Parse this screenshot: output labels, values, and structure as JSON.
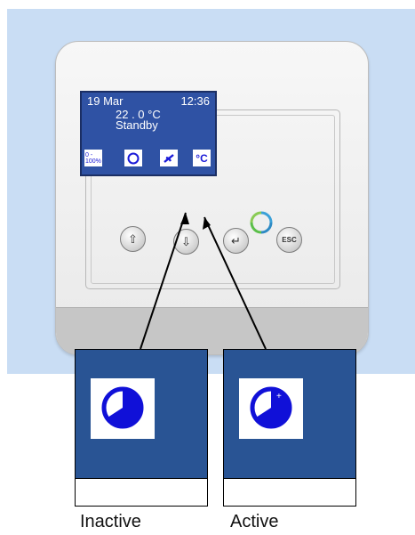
{
  "display": {
    "date": "19 Mar",
    "time": "12:36",
    "temperature": "22 . 0 °C",
    "status": "Standby",
    "icons": {
      "range_label": "0 -\n100%",
      "moon": "moon-icon",
      "fan": "fan-icon",
      "celsius": "°C"
    }
  },
  "buttons": {
    "up": "⇧",
    "down": "⇩",
    "enter": "↵",
    "esc": "ESC"
  },
  "callouts": {
    "inactive_label": "Inactive",
    "active_label": "Active"
  },
  "colors": {
    "screen_bg": "#2f52a4",
    "icon_blue": "#1a1ad8",
    "zoom_bg": "#295494",
    "page_bg": "#c9ddf4"
  }
}
